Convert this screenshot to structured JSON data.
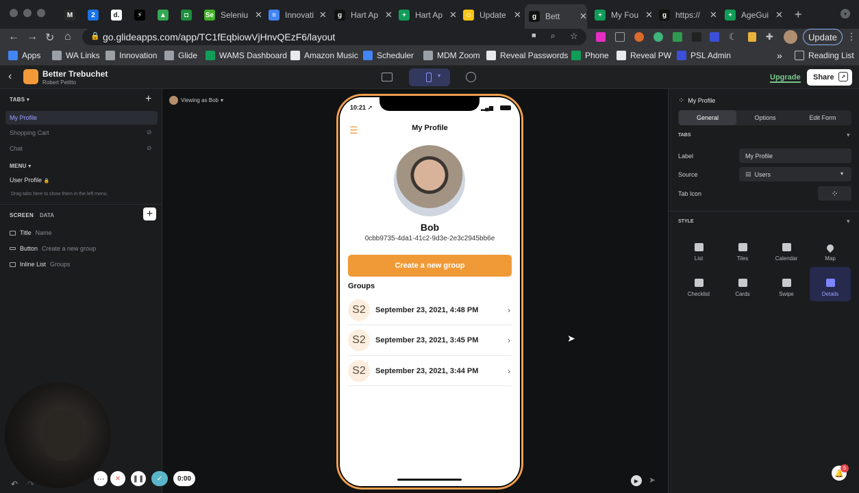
{
  "browser": {
    "tabs": [
      {
        "label": "",
        "favicon": "gmail-icon",
        "color": "#2a2a2a",
        "text": "M"
      },
      {
        "label": "",
        "favicon": "calendar-icon",
        "color": "#1a73e8",
        "text": "2"
      },
      {
        "label": "",
        "favicon": "d-icon",
        "color": "#fff",
        "text": "d."
      },
      {
        "label": "",
        "favicon": "bolt-icon",
        "color": "#000",
        "text": "⚡"
      },
      {
        "label": "",
        "favicon": "drive-icon",
        "color": "#34a853",
        "text": "▲"
      },
      {
        "label": "",
        "favicon": "screen-icon",
        "color": "#1e8e3e",
        "text": "◘"
      },
      {
        "label": "Seleniu",
        "favicon": "selenium-icon",
        "color": "#43b02a",
        "text": "Se"
      },
      {
        "label": "Innovati",
        "favicon": "docs-icon",
        "color": "#4285f4",
        "text": "≡"
      },
      {
        "label": "Hart Ap",
        "favicon": "glide-icon",
        "color": "#111",
        "text": "g"
      },
      {
        "label": "Hart Ap",
        "favicon": "sheets-icon",
        "color": "#0f9d58",
        "text": "+"
      },
      {
        "label": "Update",
        "favicon": "smile-icon",
        "color": "#f5c518",
        "text": "☺"
      },
      {
        "label": "Bett",
        "favicon": "glide-icon",
        "color": "#111",
        "text": "g"
      },
      {
        "label": "My Fou",
        "favicon": "sheets-icon",
        "color": "#0f9d58",
        "text": "+"
      },
      {
        "label": "https://",
        "favicon": "glide-icon",
        "color": "#111",
        "text": "g"
      },
      {
        "label": "AgeGui",
        "favicon": "sheets-icon",
        "color": "#0f9d58",
        "text": "+"
      }
    ],
    "url": "go.glideapps.com/app/TC1fEqbiowVjHnvQEzF6/layout",
    "update_label": "Update",
    "bookmarks": [
      "Apps",
      "WA Links",
      "Innovation",
      "Glide",
      "WAMS Dashboard",
      "Amazon Music",
      "Scheduler",
      "MDM Zoom",
      "Reveal Passwords",
      "Phone",
      "Reveal PW",
      "PSL Admin"
    ],
    "reading_list": "Reading List",
    "more": "»"
  },
  "app": {
    "name": "Better Trebuchet",
    "owner": "Robert Petitto",
    "upgrade": "Upgrade",
    "share": "Share"
  },
  "left": {
    "tabs_header": "TABS",
    "tabs": [
      "My Profile",
      "Shopping Cart",
      "Chat"
    ],
    "menu_header": "MENU",
    "menu_item": "User Profile",
    "hint": "Drag tabs here to show them in the left menu.",
    "screen_tab": "SCREEN",
    "data_tab": "DATA",
    "components": [
      {
        "type": "Title",
        "value": "Name"
      },
      {
        "type": "Button",
        "value": "Create a new group"
      },
      {
        "type": "Inline List",
        "value": "Groups"
      }
    ]
  },
  "canvas": {
    "viewing_as": "Viewing as Bob"
  },
  "phone": {
    "time": "10:21",
    "title": "My Profile",
    "user_name": "Bob",
    "user_id": "0cbb9735-4da1-41c2-9d3e-2e3c2945bb6e",
    "button_label": "Create a new group",
    "groups_header": "Groups",
    "groups": [
      {
        "avatar": "S2",
        "date": "September 23, 2021, 4:48 PM"
      },
      {
        "avatar": "S2",
        "date": "September 23, 2021, 3:45 PM"
      },
      {
        "avatar": "S2",
        "date": "September 23, 2021, 3:44 PM"
      }
    ]
  },
  "right": {
    "title": "My Profile",
    "segments": [
      "General",
      "Options",
      "Edit Form"
    ],
    "tabs_header": "TABS",
    "label_label": "Label",
    "label_value": "My Profile",
    "source_label": "Source",
    "source_value": "Users",
    "tab_icon_label": "Tab Icon",
    "style_header": "STYLE",
    "styles": [
      "List",
      "Tiles",
      "Calendar",
      "Map",
      "Checklist",
      "Cards",
      "Swipe",
      "Details"
    ],
    "selected_style": "Details",
    "notification_count": "5"
  },
  "recorder": {
    "time": "0:00"
  },
  "colors": {
    "accent_orange": "#f09a37",
    "accent_purple": "#8a92ff",
    "upgrade_green": "#79c88a"
  }
}
